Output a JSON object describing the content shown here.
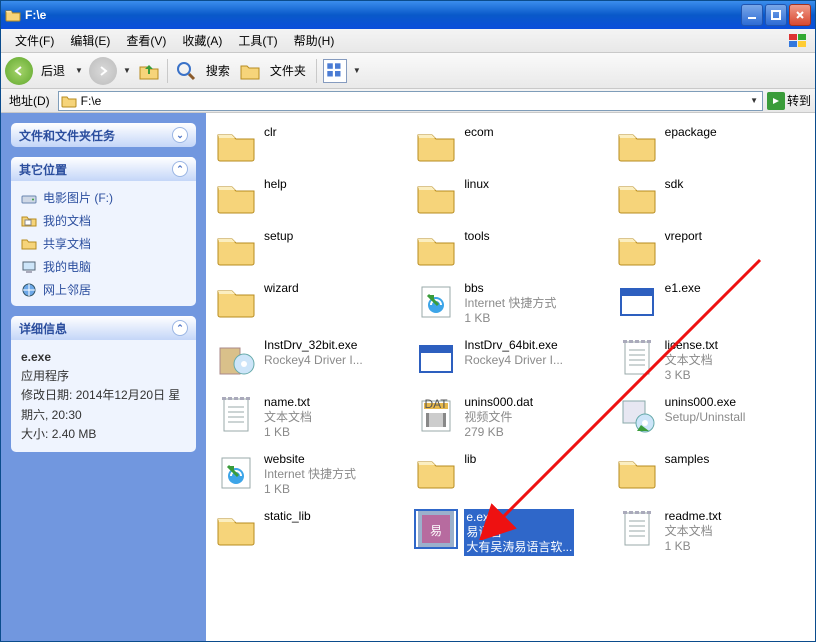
{
  "window": {
    "title": "F:\\e"
  },
  "menu": {
    "file": "文件(F)",
    "edit": "编辑(E)",
    "view": "查看(V)",
    "favorites": "收藏(A)",
    "tools": "工具(T)",
    "help": "帮助(H)"
  },
  "toolbar": {
    "back": "后退",
    "search": "搜索",
    "folders": "文件夹"
  },
  "addressbar": {
    "label": "地址(D)",
    "value": "F:\\e",
    "go": "转到"
  },
  "sidebar": {
    "tasks_title": "文件和文件夹任务",
    "places_title": "其它位置",
    "places": [
      {
        "label": "电影图片 (F:)",
        "icon": "drive"
      },
      {
        "label": "我的文档",
        "icon": "doc"
      },
      {
        "label": "共享文档",
        "icon": "shared"
      },
      {
        "label": "我的电脑",
        "icon": "computer"
      },
      {
        "label": "网上邻居",
        "icon": "network"
      }
    ],
    "details_title": "详细信息",
    "details": {
      "name": "e.exe",
      "type": "应用程序",
      "modified_label": "修改日期:",
      "modified_value": "2014年12月20日 星期六, 20:30",
      "size_label": "大小:",
      "size_value": "2.40 MB"
    }
  },
  "files": [
    {
      "name": "clr",
      "icon": "folder"
    },
    {
      "name": "ecom",
      "icon": "folder"
    },
    {
      "name": "epackage",
      "icon": "folder"
    },
    {
      "name": "help",
      "icon": "folder"
    },
    {
      "name": "linux",
      "icon": "folder"
    },
    {
      "name": "sdk",
      "icon": "folder"
    },
    {
      "name": "setup",
      "icon": "folder"
    },
    {
      "name": "tools",
      "icon": "folder"
    },
    {
      "name": "vreport",
      "icon": "folder"
    },
    {
      "name": "wizard",
      "icon": "folder"
    },
    {
      "name": "bbs",
      "sub1": "Internet 快捷方式",
      "sub2": "1 KB",
      "icon": "weblink"
    },
    {
      "name": "e1.exe",
      "icon": "app-window"
    },
    {
      "name": "InstDrv_32bit.exe",
      "sub1": "Rockey4 Driver I...",
      "icon": "installer"
    },
    {
      "name": "InstDrv_64bit.exe",
      "sub1": "Rockey4 Driver I...",
      "icon": "app-window"
    },
    {
      "name": "license.txt",
      "sub1": "文本文档",
      "sub2": "3 KB",
      "icon": "txt"
    },
    {
      "name": "name.txt",
      "sub1": "文本文档",
      "sub2": "1 KB",
      "icon": "txt"
    },
    {
      "name": "unins000.dat",
      "sub1": "视频文件",
      "sub2": "279 KB",
      "icon": "dat"
    },
    {
      "name": "unins000.exe",
      "sub1": "Setup/Uninstall",
      "icon": "uninstall"
    },
    {
      "name": "website",
      "sub1": "Internet 快捷方式",
      "sub2": "1 KB",
      "icon": "weblink"
    },
    {
      "name": "lib",
      "icon": "folder"
    },
    {
      "name": "samples",
      "icon": "folder"
    },
    {
      "name": "static_lib",
      "icon": "folder"
    },
    {
      "name": "e.exe",
      "sub1": "易语言",
      "sub2": "大有吴涛易语言软...",
      "icon": "yi",
      "selected": true
    },
    {
      "name": "readme.txt",
      "sub1": "文本文档",
      "sub2": "1 KB",
      "icon": "txt"
    }
  ]
}
